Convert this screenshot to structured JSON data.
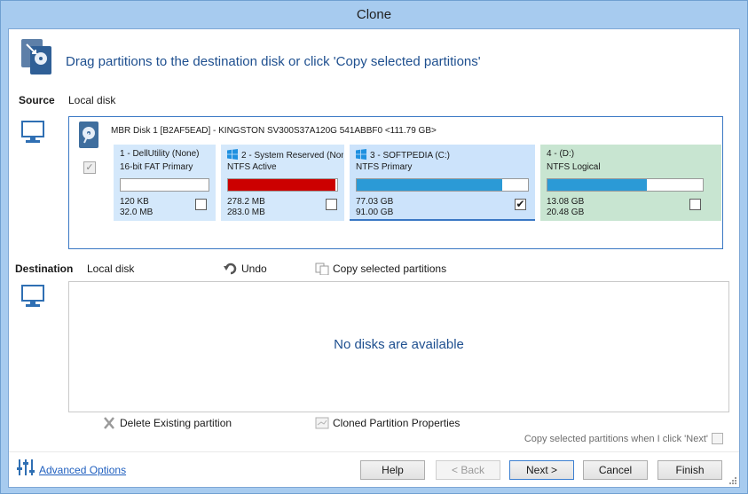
{
  "window": {
    "title": "Clone"
  },
  "header": {
    "text": "Drag partitions to the destination disk or click 'Copy selected partitions'",
    "icon": "disk-clone-icon"
  },
  "source": {
    "label": "Source",
    "disk_label": "Local disk",
    "disk": {
      "title": "MBR Disk 1 [B2AF5EAD] - KINGSTON SV300S37A120G 541ABBF0  <111.79 GB>",
      "checked": true,
      "partitions": [
        {
          "name": "1 - DellUtility (None)",
          "type": "16-bit FAT Primary",
          "used": "120 KB",
          "total": "32.0 MB",
          "fill": 0.0,
          "color": "#ffffff",
          "bg": "#d4e8fb",
          "checked": false,
          "windows": false,
          "check_mark": ""
        },
        {
          "name": "2 - System Reserved (Non",
          "type": "NTFS Active",
          "used": "278.2 MB",
          "total": "283.0 MB",
          "fill": 0.98,
          "color": "#cc0000",
          "bg": "#d4e8fb",
          "checked": false,
          "windows": true,
          "check_mark": ""
        },
        {
          "name": "3 - SOFTPEDIA (C:)",
          "type": "NTFS Primary",
          "used": "77.03 GB",
          "total": "91.00 GB",
          "fill": 0.85,
          "color": "#2b9ad6",
          "bg": "#cce3fb",
          "checked": true,
          "windows": true,
          "check_mark": "✔"
        },
        {
          "name": "4 -  (D:)",
          "type": "NTFS Logical",
          "used": "13.08 GB",
          "total": "20.48 GB",
          "fill": 0.64,
          "color": "#2b9ad6",
          "bg": "#c8e5d1",
          "checked": false,
          "windows": false,
          "check_mark": ""
        }
      ]
    }
  },
  "destination": {
    "label": "Destination",
    "disk_label": "Local disk",
    "undo_label": "Undo",
    "copy_label": "Copy selected partitions",
    "empty_text": "No disks are available",
    "delete_label": "Delete Existing partition",
    "cloned_props_label": "Cloned Partition Properties",
    "copy_on_next_label": "Copy selected partitions when I click 'Next'"
  },
  "footer": {
    "advanced_label": "Advanced Options",
    "buttons": {
      "help": "Help",
      "back": "< Back",
      "next": "Next >",
      "cancel": "Cancel",
      "finish": "Finish"
    }
  }
}
